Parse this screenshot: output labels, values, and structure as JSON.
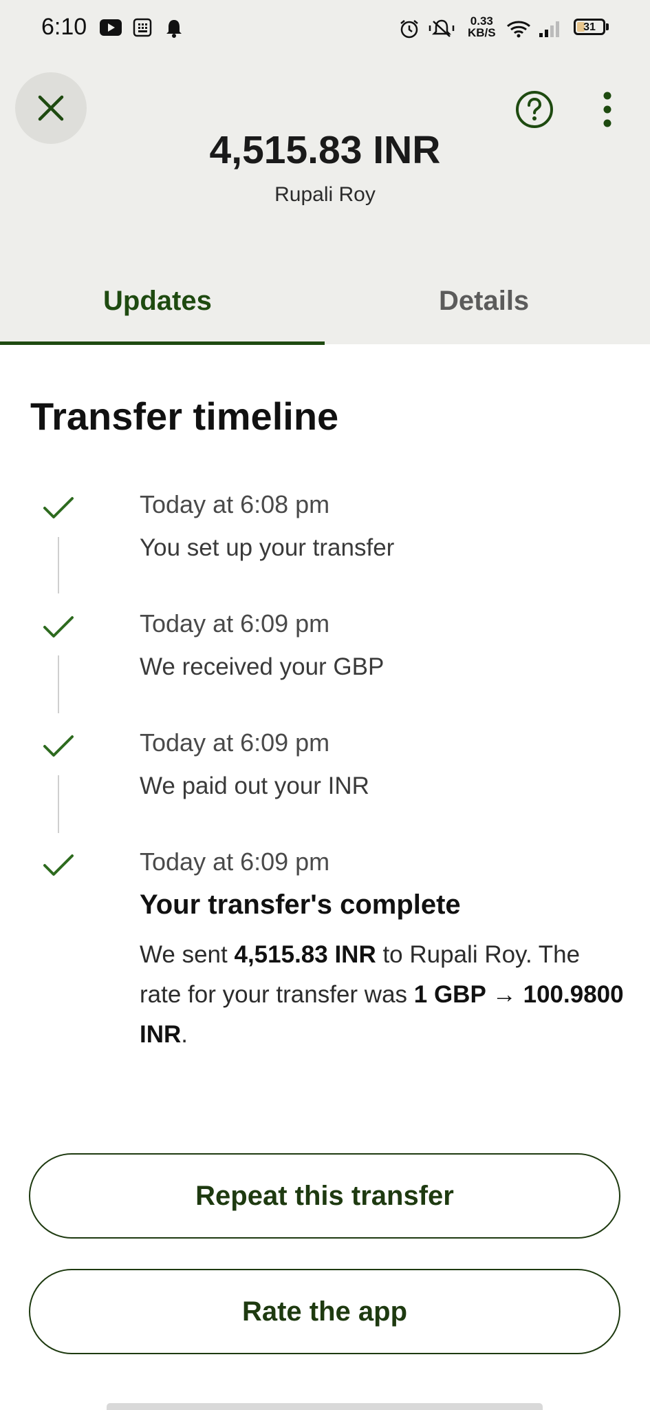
{
  "status_bar": {
    "time": "6:10",
    "net_speed_value": "0.33",
    "net_speed_unit": "KB/S",
    "battery": "31",
    "battery_level": 0.31,
    "icons": [
      "youtube-icon",
      "calculator-icon",
      "bell-icon",
      "alarm-icon",
      "mute-icon",
      "wifi-icon",
      "signal-icon",
      "battery-icon"
    ]
  },
  "header": {
    "close_icon": "close-icon",
    "help_icon": "help-circle-icon",
    "more_icon": "more-vertical-icon",
    "amount": "4,515.83 INR",
    "recipient": "Rupali Roy"
  },
  "tabs": [
    {
      "label": "Updates",
      "active": true
    },
    {
      "label": "Details",
      "active": false
    }
  ],
  "timeline": {
    "title": "Transfer timeline",
    "events": [
      {
        "time": "Today at 6:08 pm",
        "description": "You set up your transfer"
      },
      {
        "time": "Today at 6:09 pm",
        "description": "We received your GBP"
      },
      {
        "time": "Today at 6:09 pm",
        "description": "We paid out your INR"
      },
      {
        "time": "Today at 6:09 pm",
        "heading": "Your transfer's complete",
        "body_parts": {
          "p1": "We sent ",
          "amount": "4,515.83 INR",
          "p2": " to Rupali Roy. The rate for your transfer was ",
          "rate": "1 GBP → 100.9800 INR",
          "p3": "."
        }
      }
    ]
  },
  "actions": {
    "repeat_label": "Repeat this transfer",
    "rate_label": "Rate the app"
  },
  "colors": {
    "accent": "#1e4a10",
    "header_bg": "#eeeeeb",
    "check": "#2e6b1f"
  }
}
